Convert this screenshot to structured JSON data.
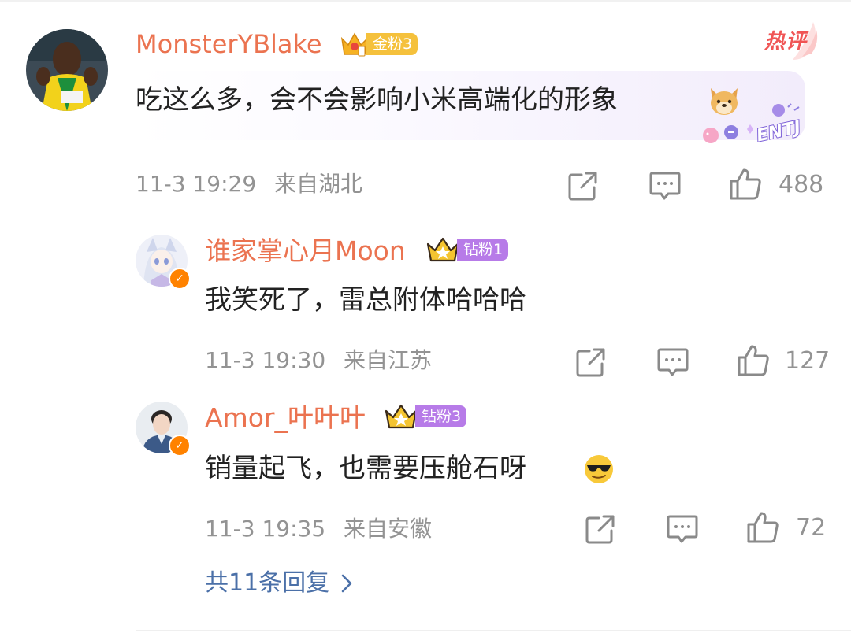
{
  "main_comment": {
    "username": "MonsterYBlake",
    "fan_badge": "金粉3",
    "hot_tag": "热评",
    "text": "吃这么多，会不会影响小米高端化的形象",
    "emoji": "dog-face-emoji",
    "decoration": "ENTJ",
    "time": "11-3 19:29",
    "location": "来自湖北",
    "likes": "488"
  },
  "replies": [
    {
      "username": "谁家掌心月Moon",
      "fan_badge": "钻粉1",
      "text": "我笑死了，雷总附体哈哈哈",
      "time": "11-3 19:30",
      "location": "来自江苏",
      "likes": "127",
      "verified": true
    },
    {
      "username": "Amor_叶叶叶",
      "fan_badge": "钻粉3",
      "text": "销量起飞，也需要压舱石呀",
      "emoji": "sunglasses-face-emoji",
      "time": "11-3 19:35",
      "location": "来自安徽",
      "likes": "72",
      "verified": true
    }
  ],
  "more_replies_label": "共11条回复",
  "colors": {
    "username": "#eb7350",
    "meta": "#939393",
    "link": "#4b70a8",
    "hot": "#f05555",
    "gold_badge": "#f5c13c",
    "diamond_badge": "#b77be8",
    "verified": "#ff8200"
  },
  "icons": [
    "share-icon",
    "comment-icon",
    "like-icon",
    "chevron-right-icon",
    "crown-icon",
    "verified-icon"
  ]
}
